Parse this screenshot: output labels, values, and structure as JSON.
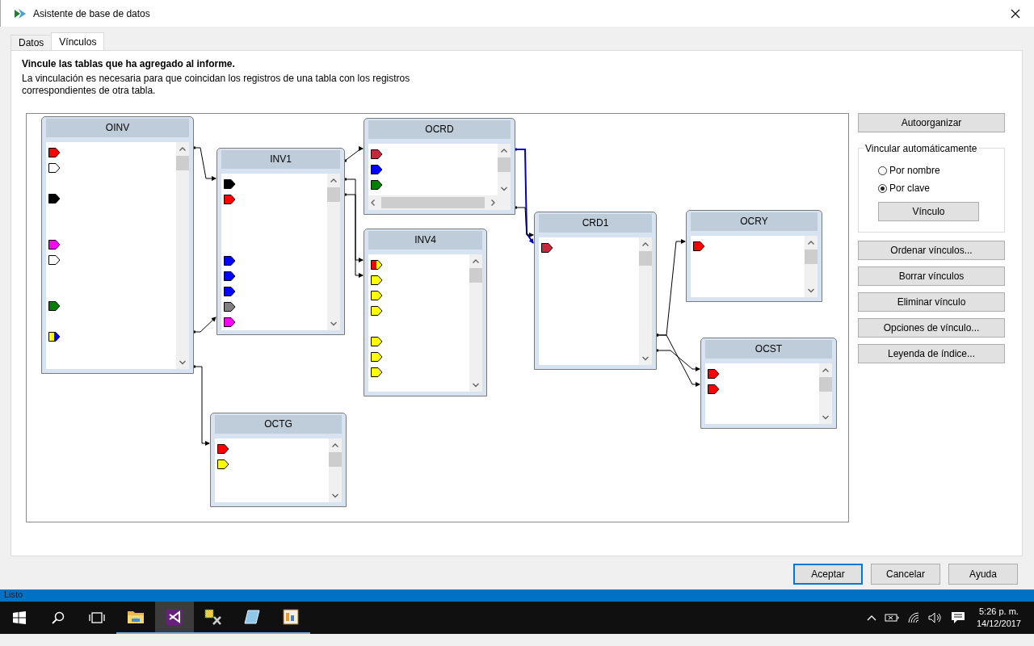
{
  "window": {
    "title": "Asistente de base de datos"
  },
  "tabs": [
    {
      "label": "Datos",
      "selected": false
    },
    {
      "label": "Vínculos",
      "selected": true
    }
  ],
  "heading": "Vincule las tablas que ha agregado al informe.",
  "description": "La vinculación es necesaria para que coincidan los registros de una tabla con los registros correspondientes de otra tabla.",
  "tables": [
    {
      "name": "OINV",
      "fields": [
        {
          "kind": "key",
          "color": "#ff0000"
        },
        {
          "kind": "hollow"
        },
        {
          "kind": "blank"
        },
        {
          "kind": "key",
          "color": "#000000"
        },
        {
          "kind": "blank"
        },
        {
          "kind": "blank"
        },
        {
          "kind": "key",
          "color": "#ff00ff"
        },
        {
          "kind": "hollow"
        },
        {
          "kind": "blank"
        },
        {
          "kind": "blank"
        },
        {
          "kind": "key",
          "color": "#008000"
        },
        {
          "kind": "blank"
        },
        {
          "kind": "split",
          "parts": [
            {
              "color": "#ffff00"
            },
            {
              "color": "#0000ff"
            }
          ]
        }
      ]
    },
    {
      "name": "INV1",
      "fields": [
        {
          "kind": "key",
          "color": "#000000"
        },
        {
          "kind": "key",
          "color": "#ff0000"
        },
        {
          "kind": "blank"
        },
        {
          "kind": "blank"
        },
        {
          "kind": "blank"
        },
        {
          "kind": "key",
          "color": "#0000ff"
        },
        {
          "kind": "key",
          "color": "#0000ff"
        },
        {
          "kind": "key",
          "color": "#0000ff"
        },
        {
          "kind": "key",
          "color": "#808080"
        },
        {
          "kind": "key",
          "color": "#ff00ff"
        }
      ]
    },
    {
      "name": "OCRD",
      "fields": [
        {
          "kind": "key",
          "color": "#c8283c"
        },
        {
          "kind": "key",
          "color": "#0000ff"
        },
        {
          "kind": "key",
          "color": "#008000"
        }
      ]
    },
    {
      "name": "INV4",
      "fields": [
        {
          "kind": "split",
          "parts": [
            {
              "color": "#ff0000"
            },
            {
              "color": "#ffff00"
            }
          ]
        },
        {
          "kind": "key",
          "color": "#ffff00"
        },
        {
          "kind": "key",
          "color": "#ffff00"
        },
        {
          "kind": "key",
          "color": "#ffff00"
        },
        {
          "kind": "blank"
        },
        {
          "kind": "key",
          "color": "#ffff00"
        },
        {
          "kind": "key",
          "color": "#ffff00"
        },
        {
          "kind": "key",
          "color": "#ffff00"
        }
      ]
    },
    {
      "name": "CRD1",
      "fields": [
        {
          "kind": "key",
          "color": "#c8283c"
        }
      ]
    },
    {
      "name": "OCRY",
      "fields": [
        {
          "kind": "key",
          "color": "#ff0000"
        }
      ]
    },
    {
      "name": "OCST",
      "fields": [
        {
          "kind": "key",
          "color": "#ff0000"
        },
        {
          "kind": "key",
          "color": "#ff0000"
        }
      ]
    },
    {
      "name": "OCTG",
      "fields": [
        {
          "kind": "key",
          "color": "#ff0000"
        },
        {
          "kind": "key",
          "color": "#ffff00"
        }
      ]
    }
  ],
  "organize_button": "Autoorganizar",
  "auto_link": {
    "legend": "Vincular automáticamente",
    "options": [
      {
        "label": "Por nombre",
        "selected": false
      },
      {
        "label": "Por clave",
        "selected": true
      }
    ],
    "button": "Vínculo"
  },
  "link_buttons": [
    "Ordenar vínculos...",
    "Borrar vínculos",
    "Eliminar vínculo",
    "Opciones de vínculo...",
    "Leyenda de índice..."
  ],
  "dialog_buttons": [
    {
      "label": "Aceptar",
      "default": true
    },
    {
      "label": "Cancelar",
      "default": false
    },
    {
      "label": "Ayuda",
      "default": false
    }
  ],
  "status_bar": "Listo",
  "taskbar": {
    "apps": [
      {
        "kind": "folder",
        "selected": false
      },
      {
        "kind": "studio",
        "selected": true
      },
      {
        "kind": "tools",
        "selected": false
      },
      {
        "kind": "notepad",
        "selected": false
      },
      {
        "kind": "designer",
        "selected": false
      }
    ],
    "clock": {
      "time": "5:26 p. m.",
      "date": "14/12/2017"
    }
  }
}
